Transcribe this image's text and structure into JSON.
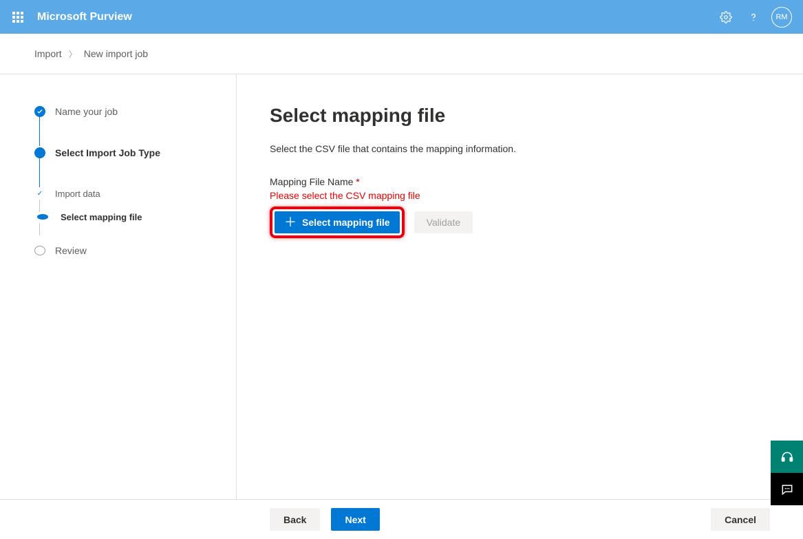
{
  "header": {
    "app_title": "Microsoft Purview",
    "avatar_initials": "RM"
  },
  "breadcrumb": {
    "parent": "Import",
    "current": "New import job"
  },
  "wizard": {
    "steps": [
      {
        "label": "Name your job"
      },
      {
        "label": "Select Import Job Type"
      },
      {
        "label": "Import data"
      },
      {
        "label": "Select mapping file"
      },
      {
        "label": "Review"
      }
    ]
  },
  "page": {
    "title": "Select mapping file",
    "description": "Select the CSV file that contains the mapping information.",
    "field_label": "Mapping File Name",
    "required_marker": "*",
    "error_message": "Please select the CSV mapping file",
    "select_button": "Select mapping file",
    "validate_button": "Validate"
  },
  "footer": {
    "back": "Back",
    "next": "Next",
    "cancel": "Cancel"
  }
}
